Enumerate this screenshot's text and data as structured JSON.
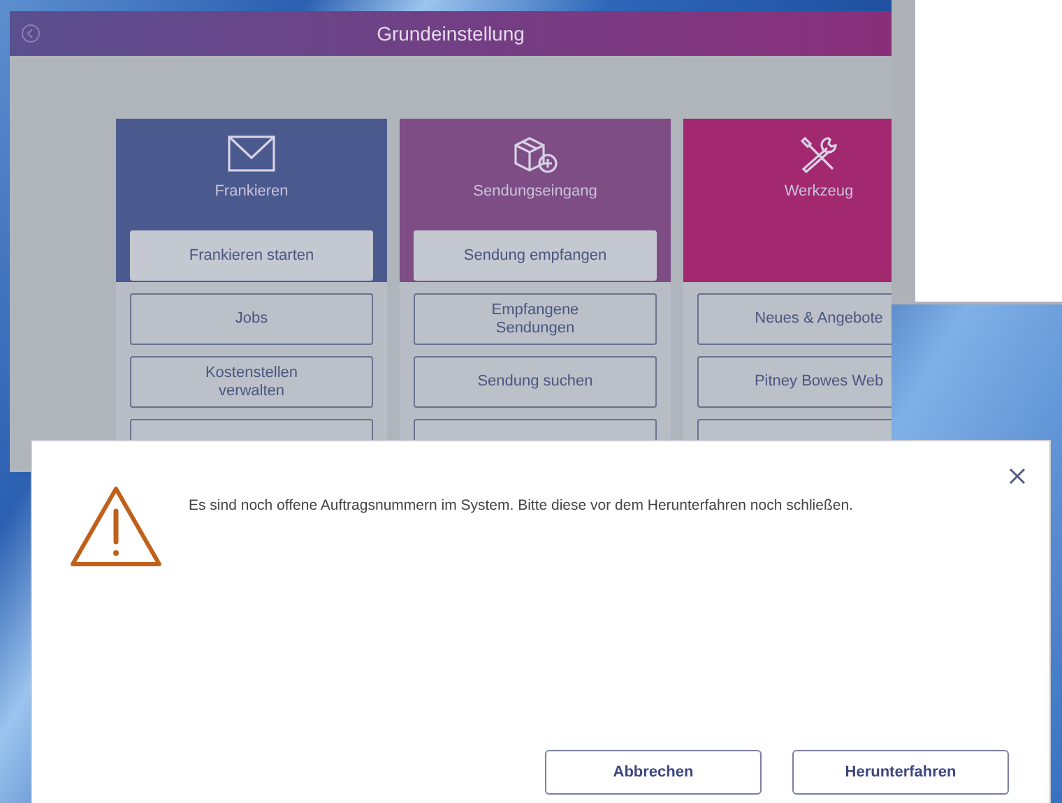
{
  "window": {
    "title": "Grundeinstellung"
  },
  "columns": [
    {
      "kind": "mail",
      "title": "Frankieren",
      "color": "#4a5a8f",
      "primary_button": "Frankieren starten",
      "items": [
        "Jobs",
        "Kostenstellen verwalten"
      ]
    },
    {
      "kind": "package",
      "title": "Sendungseingang",
      "color": "#7e4d86",
      "primary_button": "Sendung empfangen",
      "items": [
        "Empfangene Sendungen",
        "Sendung suchen"
      ]
    },
    {
      "kind": "tools",
      "title": "Werkzeug",
      "color": "#a2286f",
      "items": [
        "Neues & Angebote",
        "Pitney Bowes Web"
      ]
    }
  ],
  "dialog": {
    "message": "Es sind noch offene Auftragsnummern im System. Bitte diese vor dem Herunterfahren noch schließen.",
    "buttons": [
      "Abbrechen",
      "Herunterfahren"
    ]
  }
}
